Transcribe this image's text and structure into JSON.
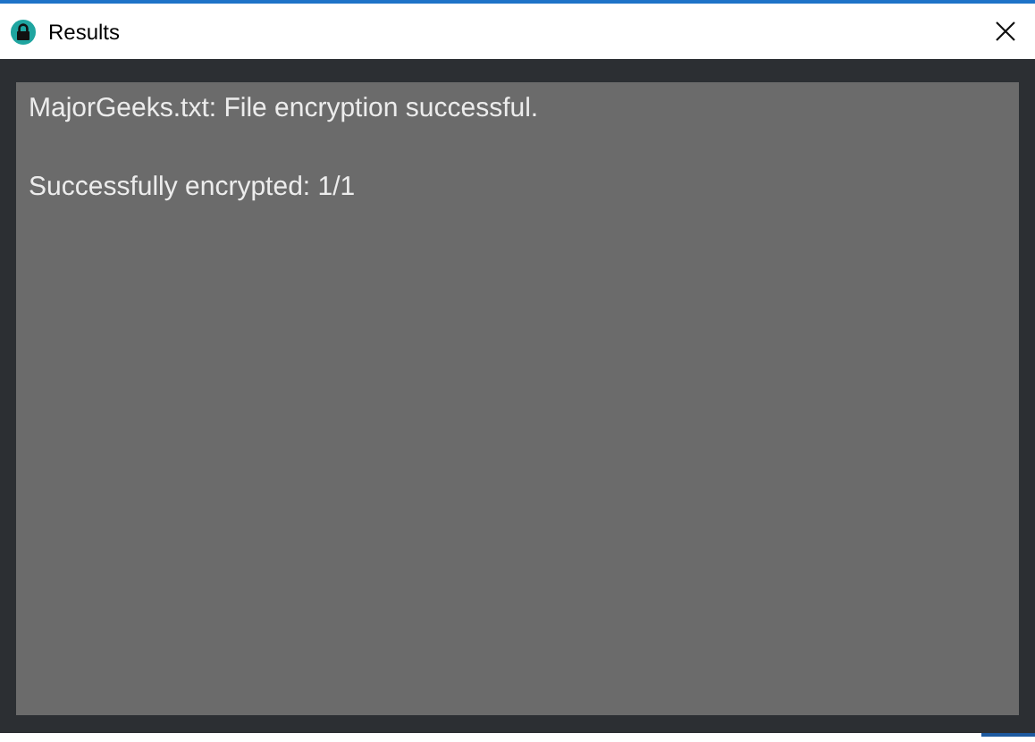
{
  "window": {
    "title": "Results"
  },
  "output": {
    "lines": [
      "MajorGeeks.txt: File encryption successful.",
      "Successfully encrypted: 1/1"
    ]
  }
}
